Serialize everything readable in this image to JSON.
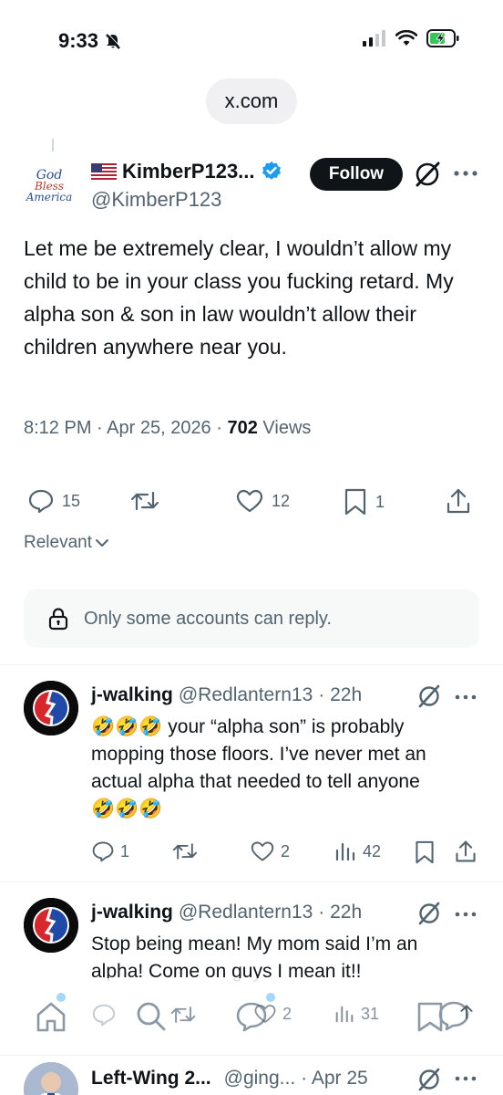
{
  "status_bar": {
    "time": "9:33"
  },
  "browser": {
    "url": "x.com"
  },
  "main_post": {
    "author_name": "KimberP123...",
    "author_handle": "@KimberP123",
    "avatar_text": [
      "God",
      "Bless",
      "America"
    ],
    "follow_label": "Follow",
    "text": "Let me be extremely clear, I wouldn’t allow my child to be in your class you fucking retard. My alpha son & son in law wouldn’t allow their children anywhere near you.",
    "time_date": "8:12 PM · Apr 25, 2026 · ",
    "views_count": "702",
    "views_label": " Views",
    "replies": "15",
    "reposts": "",
    "likes": "12",
    "bookmarks": "1"
  },
  "sort_label": "Relevant",
  "reply_restriction": "Only some accounts can reply.",
  "replies": [
    {
      "name": "j-walking",
      "handle": "@Redlantern13",
      "time": "· 22h",
      "text_line1": "🤣🤣🤣 your “alpha son” is probably",
      "text_line2": "mopping those floors. I’ve never met an",
      "text_line3": "actual alpha that needed to tell anyone",
      "text_line4": "🤣🤣🤣",
      "replies": "1",
      "reposts": "",
      "likes": "2",
      "views": "42"
    },
    {
      "name": "j-walking",
      "handle": "@Redlantern13",
      "time": "· 22h",
      "text_line1": "Stop being mean! My mom said I’m an",
      "text_line2": "alpha! Come on guys I mean it!!",
      "likes": "2",
      "views": "31"
    },
    {
      "name": "Left-Wing 2...",
      "handle": "@ging...",
      "time": "· Apr 25"
    }
  ],
  "colors": {
    "accent": "#1d9bf0",
    "text": "#0f1419",
    "muted": "#536471",
    "follow_bg": "#0f1419"
  },
  "icons": [
    "mute-icon",
    "signal-icon",
    "wifi-icon",
    "battery-icon",
    "verified-icon",
    "grok-icon",
    "more-icon",
    "reply-icon",
    "repost-icon",
    "like-icon",
    "bookmark-icon",
    "share-icon",
    "views-icon",
    "lock-icon",
    "home-icon",
    "search-icon",
    "communities-icon",
    "notifications-icon",
    "messages-icon",
    "chevron-down-icon"
  ]
}
